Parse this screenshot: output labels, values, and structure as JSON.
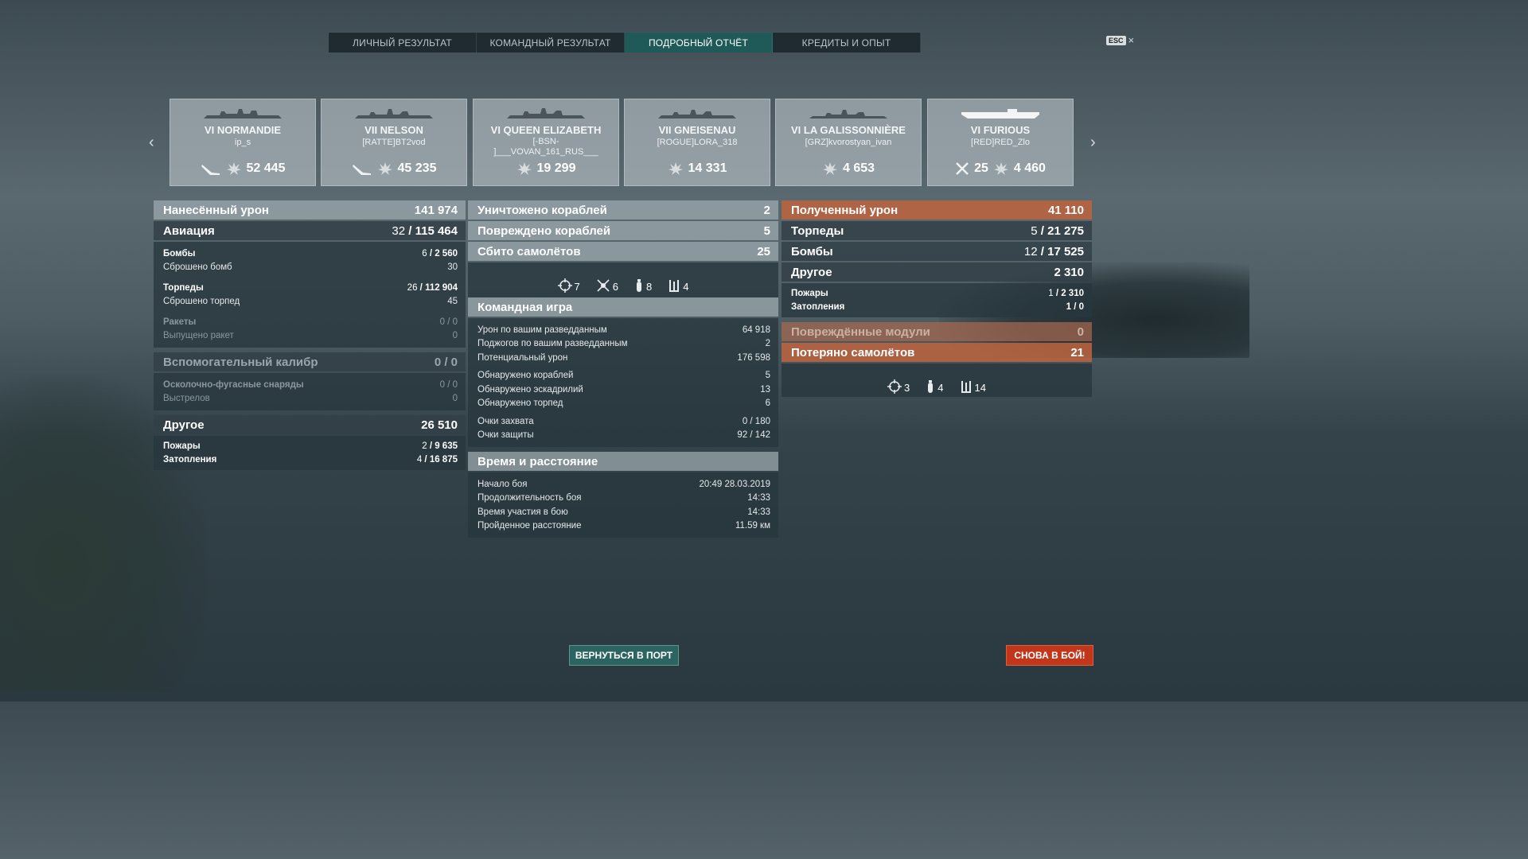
{
  "tabs": [
    "ЛИЧНЫЙ РЕЗУЛЬТАТ",
    "КОМАНДНЫЙ РЕЗУЛЬТАТ",
    "ПОДРОБНЫЙ ОТЧЁТ",
    "КРЕДИТЫ И ОПЫТ"
  ],
  "active_tab": "ПОДРОБНЫЙ ОТЧЁТ",
  "esc": {
    "key": "ESC",
    "close": "×"
  },
  "ships": [
    {
      "tier": "VI",
      "name": "VI NORMANDIE",
      "player": "ip_s",
      "damage": "52 445",
      "extra": ""
    },
    {
      "tier": "VII",
      "name": "VII NELSON",
      "player": "[RATTE]BT2vod",
      "damage": "45 235",
      "extra": ""
    },
    {
      "tier": "VI",
      "name": "VI QUEEN ELIZABETH",
      "player": "[-BSN-",
      "player2": "]___VOVAN_161_RUS___",
      "damage": "19 299",
      "extra": ""
    },
    {
      "tier": "VII",
      "name": "VII GNEISENAU",
      "player": "[ROGUE]LORA_318",
      "damage": "14 331",
      "extra": ""
    },
    {
      "tier": "VI",
      "name": "VI LA GALISSONNIÈRE",
      "player": "[GRZ]kvorostyan_ivan",
      "damage": "4 653",
      "extra": ""
    },
    {
      "tier": "VI",
      "name": "VI FURIOUS",
      "player": "[RED]RED_Zlo",
      "damage": "4 460",
      "extra": "25"
    }
  ],
  "left": {
    "dealt": {
      "label": "Нанесённый урон",
      "value": "141 974"
    },
    "aviation": {
      "label": "Авиация",
      "hits": "32",
      "value": "115 464"
    },
    "bombs": {
      "label": "Бомбы",
      "hits": "6",
      "value": "2 560"
    },
    "bombs_dropped": {
      "label": "Сброшено бомб",
      "value": "30"
    },
    "torps": {
      "label": "Торпеды",
      "hits": "26",
      "value": "112 904"
    },
    "torps_dropped": {
      "label": "Сброшено торпед",
      "value": "45"
    },
    "rockets": {
      "label": "Ракеты",
      "value": "0 / 0"
    },
    "rockets_fired": {
      "label": "Выпущено ракет",
      "value": "0"
    },
    "secondary": {
      "label": "Вспомогательный калибр",
      "value": "0 / 0"
    },
    "he": {
      "label": "Осколочно-фугасные снаряды",
      "value": "0 / 0"
    },
    "shots": {
      "label": "Выстрелов",
      "value": "0"
    },
    "other": {
      "label": "Другое",
      "value": "26 510"
    },
    "fires": {
      "label": "Пожары",
      "hits": "2",
      "value": "9 635"
    },
    "floods": {
      "label": "Затопления",
      "hits": "4",
      "value": "16 875"
    }
  },
  "middle": {
    "destroyed": {
      "label": "Уничтожено кораблей",
      "value": "2"
    },
    "damaged": {
      "label": "Повреждено кораблей",
      "value": "5"
    },
    "planes": {
      "label": "Сбито самолётов",
      "value": "25"
    },
    "plane_icons": [
      {
        "icon": "crosshair-icon",
        "value": "7"
      },
      {
        "icon": "plane-burst-icon",
        "value": "6"
      },
      {
        "icon": "bomb-icon",
        "value": "8"
      },
      {
        "icon": "torpedo-icon",
        "value": "4"
      }
    ],
    "team": {
      "label": "Командная игра",
      "rows": [
        {
          "label": "Урон по вашим разведданным",
          "value": "64 918"
        },
        {
          "label": "Поджогов по вашим разведданным",
          "value": "2"
        },
        {
          "label": "Потенциальный урон",
          "value": "176 598"
        },
        {
          "label": "Обнаружено кораблей",
          "value": "5"
        },
        {
          "label": "Обнаружено эскадрилий",
          "value": "13"
        },
        {
          "label": "Обнаружено торпед",
          "value": "6"
        },
        {
          "label": "Очки захвата",
          "value": "0 / 180"
        },
        {
          "label": "Очки защиты",
          "value": "92 / 142"
        }
      ]
    },
    "time": {
      "label": "Время и расстояние",
      "rows": [
        {
          "label": "Начало боя",
          "value": "20:49  28.03.2019"
        },
        {
          "label": "Продолжительность боя",
          "value": "14:33"
        },
        {
          "label": "Время участия в бою",
          "value": "14:33"
        },
        {
          "label": "Пройденное расстояние",
          "value": "11.59 км"
        }
      ]
    }
  },
  "right": {
    "received": {
      "label": "Полученный урон",
      "value": "41 110"
    },
    "torps": {
      "label": "Торпеды",
      "hits": "5",
      "value": "21 275"
    },
    "bombs": {
      "label": "Бомбы",
      "hits": "12",
      "value": "17 525"
    },
    "other": {
      "label": "Другое",
      "value": "2 310"
    },
    "fires": {
      "label": "Пожары",
      "hits": "1",
      "value": "2 310"
    },
    "floods": {
      "label": "Затопления",
      "value": "1 / 0"
    },
    "modules": {
      "label": "Повреждённые модули",
      "value": "0"
    },
    "planes_lost": {
      "label": "Потеряно самолётов",
      "value": "21"
    },
    "plane_icons": [
      {
        "icon": "crosshair-icon",
        "value": "3"
      },
      {
        "icon": "bomb-icon",
        "value": "4"
      },
      {
        "icon": "torpedo-icon",
        "value": "14"
      }
    ]
  },
  "buttons": {
    "port": "ВЕРНУТЬСЯ В ПОРТ",
    "battle": "СНОВА В БОЙ!"
  },
  "colors": {
    "accent_tab": "#1f5a58",
    "battle_button": "#c2361c",
    "port_button": "#2b6460",
    "received_header": "#be643e"
  }
}
